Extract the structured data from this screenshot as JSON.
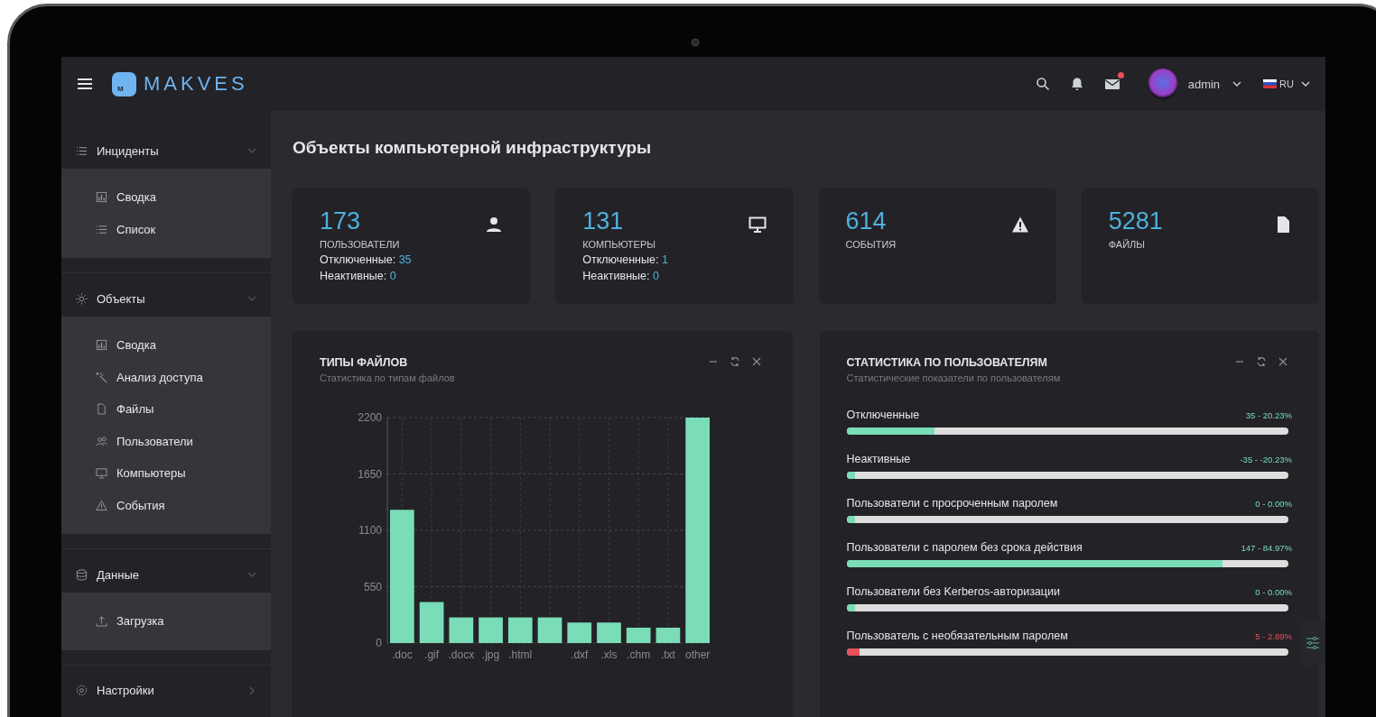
{
  "header": {
    "logo_mark": "M",
    "brand": "MAKVES",
    "mail_unread": true,
    "user": "admin",
    "language": "RU"
  },
  "sidebar": {
    "sections": [
      {
        "label": "Инциденты",
        "kind": "list",
        "expanded": true,
        "children": [
          {
            "label": "Сводка",
            "kind": "chart"
          },
          {
            "label": "Список",
            "kind": "list"
          }
        ]
      },
      {
        "label": "Объекты",
        "kind": "sun",
        "expanded": true,
        "children": [
          {
            "label": "Сводка",
            "kind": "chart"
          },
          {
            "label": "Анализ доступа",
            "kind": "wand"
          },
          {
            "label": "Файлы",
            "kind": "file"
          },
          {
            "label": "Пользователи",
            "kind": "users"
          },
          {
            "label": "Компьютеры",
            "kind": "monitor"
          },
          {
            "label": "События",
            "kind": "warning"
          }
        ]
      },
      {
        "label": "Данные",
        "kind": "database",
        "expanded": true,
        "children": [
          {
            "label": "Загрузка",
            "kind": "upload"
          }
        ]
      },
      {
        "label": "Настройки",
        "kind": "gear",
        "expanded": false
      }
    ]
  },
  "page_title": "Объекты компьютерной инфраструктуры",
  "stats": [
    {
      "kind": "user",
      "value": "173",
      "label": "ПОЛЬЗОВАТЕЛИ",
      "details": [
        {
          "label": "Отключенные:",
          "value": "35"
        },
        {
          "label": "Неактивные:",
          "value": "0"
        }
      ]
    },
    {
      "kind": "monitor",
      "value": "131",
      "label": "КОМПЬЮТЕРЫ",
      "details": [
        {
          "label": "Отключенные:",
          "value": "1"
        },
        {
          "label": "Неактивные:",
          "value": "0"
        }
      ]
    },
    {
      "kind": "warning",
      "value": "614",
      "label": "СОБЫТИЯ"
    },
    {
      "kind": "file",
      "value": "5281",
      "label": "ФАЙЛЫ"
    }
  ],
  "file_types_panel": {
    "title": "ТИПЫ ФАЙЛОВ",
    "subtitle": "Статистика по типам файлов",
    "chart_data": {
      "type": "bar",
      "categories": [
        ".doc",
        ".gif",
        ".docx",
        ".jpg",
        ".html",
        null,
        ".dxf",
        ".xls",
        ".chm",
        ".txt",
        "other"
      ],
      "series": [
        {
          "color": "#7addb8",
          "values": [
            1300,
            400,
            250,
            250,
            250,
            250,
            200,
            200,
            150,
            150,
            2200
          ]
        }
      ],
      "ylim": [
        0,
        2200
      ],
      "yticks": [
        0,
        550,
        1100,
        1650,
        2200
      ],
      "grid": true
    }
  },
  "users_panel": {
    "title": "СТАТИСТИКА ПО ПОЛЬЗОВАТЕЛЯМ",
    "subtitle": "Статистические показатели по пользователям",
    "rows": [
      {
        "label": "Отключенные",
        "reading": "35 - 20.23%",
        "level": 0.2,
        "color": "#7addb8"
      },
      {
        "label": "Неактивные",
        "reading": "-35 - -20.23%",
        "level": 0.02,
        "color": "#7addb8"
      },
      {
        "label": "Пользователи с просроченным паролем",
        "reading": "0 - 0.00%",
        "level": 0.02,
        "color": "#7addb8"
      },
      {
        "label": "Пользователи с паролем без срока действия",
        "reading": "147 - 84.97%",
        "level": 0.85,
        "color": "#7addb8"
      },
      {
        "label": "Пользователи без Kerberos-авторизации",
        "reading": "0 - 0.00%",
        "level": 0.02,
        "color": "#7addb8"
      },
      {
        "label": "Пользователь с необязательным паролем",
        "reading": "5 - 2.89%",
        "level": 0.03,
        "color": "#e8505b"
      }
    ]
  }
}
